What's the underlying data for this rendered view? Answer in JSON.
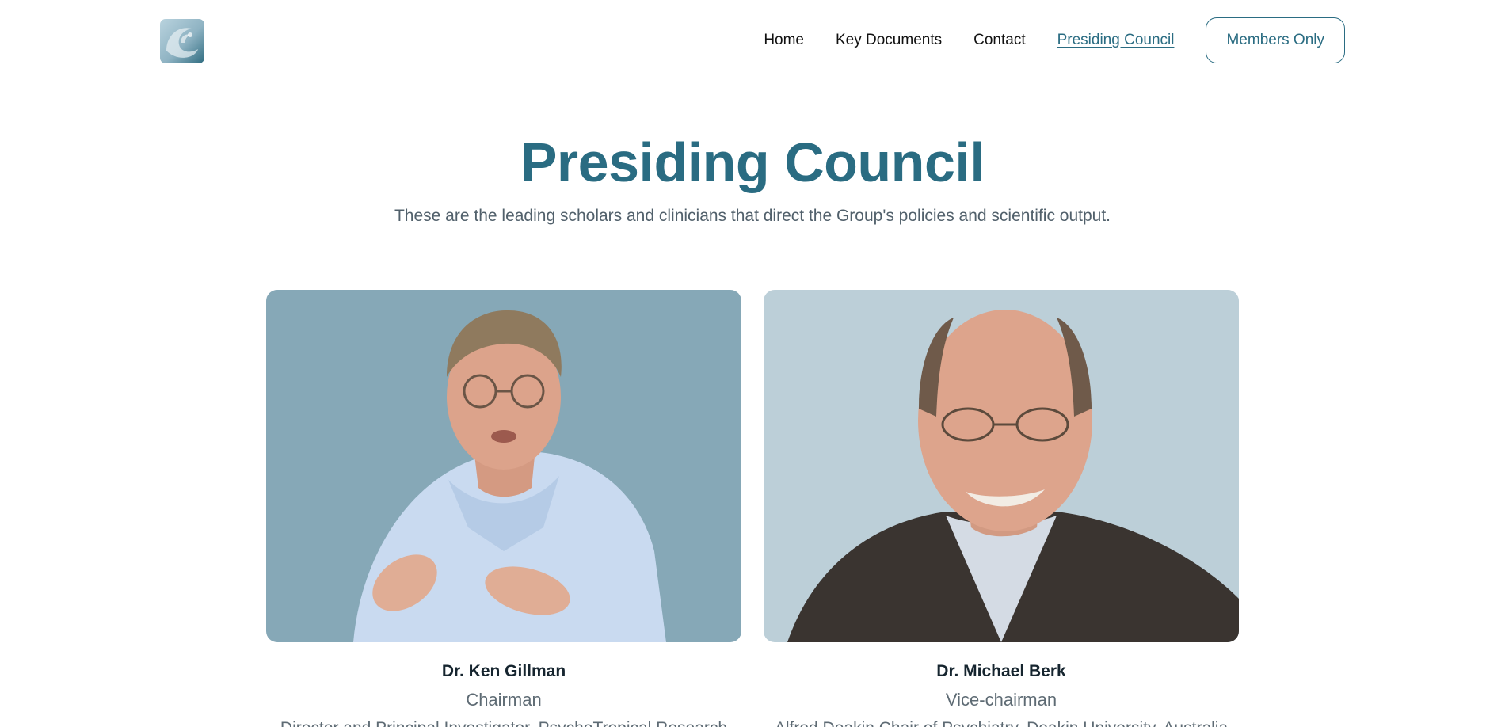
{
  "header": {
    "nav": [
      {
        "label": "Home"
      },
      {
        "label": "Key Documents"
      },
      {
        "label": "Contact"
      },
      {
        "label": "Presiding Council",
        "active": true
      }
    ],
    "members_button": "Members Only"
  },
  "hero": {
    "title": "Presiding Council",
    "subtitle": "These are the leading scholars and clinicians that direct the Group's policies and scientific output."
  },
  "members": [
    {
      "name": "Dr. Ken Gillman",
      "role": "Chairman",
      "description": "Director and Principal Investigator, PsychoTropical Research"
    },
    {
      "name": "Dr. Michael Berk",
      "role": "Vice-chairman",
      "description": "Alfred Deakin Chair of Psychiatry, Deakin University, Australia"
    }
  ],
  "colors": {
    "accent": "#2a6c82",
    "text": "#16252f",
    "muted": "#5e6b74",
    "photo1_bg": "#86a8b7",
    "photo2_bg": "#bccfd8"
  }
}
